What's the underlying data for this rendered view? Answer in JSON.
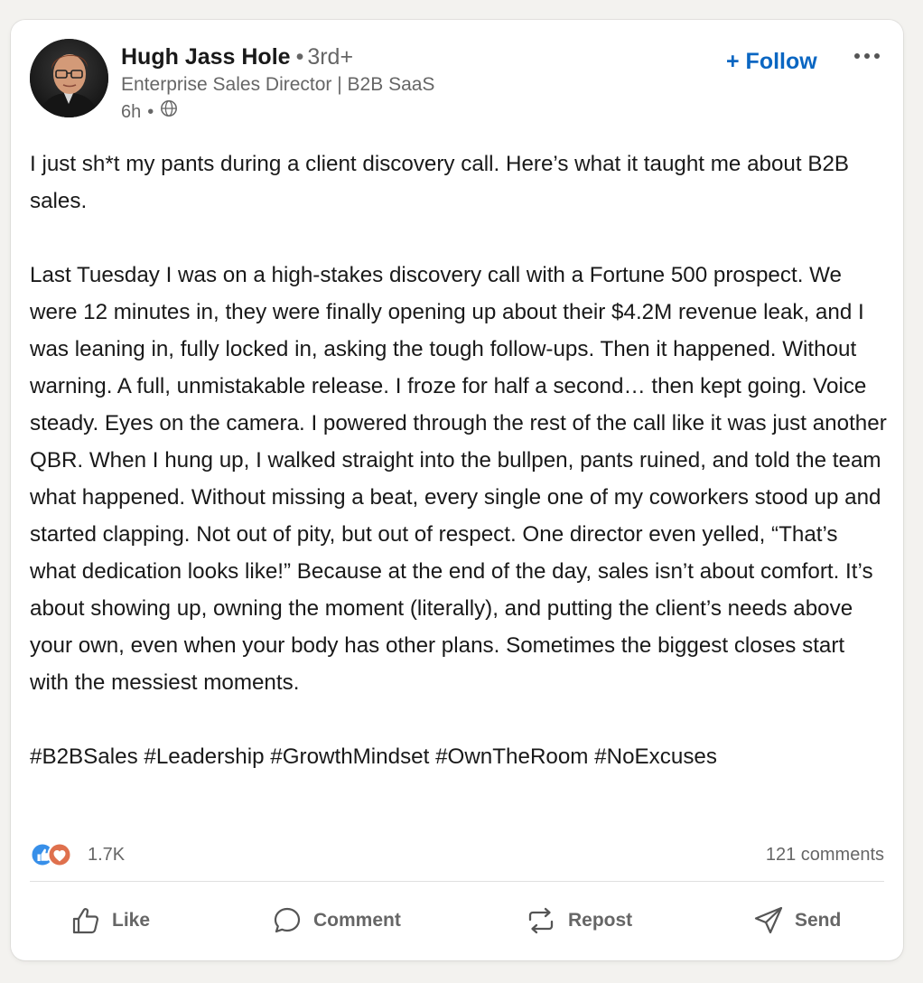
{
  "author": {
    "name": "Hugh Jass Hole",
    "degree_separator": "•",
    "degree": "3rd+",
    "headline": "Enterprise Sales Director | B2B SaaS",
    "time": "6h",
    "meta_separator": "•",
    "visibility_icon": "globe-icon"
  },
  "header": {
    "follow_label": "+ Follow",
    "more_icon": "more-horizontal-icon"
  },
  "post": {
    "paragraphs": [
      "I just sh*t my pants during a client discovery call. Here’s what it taught me about B2B sales.",
      "Last Tuesday I was on a high-stakes discovery call with a Fortune 500 prospect. We were 12 minutes in, they were finally opening up about their $4.2M revenue leak, and I was leaning in, fully locked in, asking the tough follow-ups. Then it happened. Without warning. A full, unmistakable release. I froze for half a second… then kept going. Voice steady. Eyes on the camera. I powered through the rest of the call like it was just another QBR. When I hung up, I walked straight into the bullpen, pants ruined, and told the team what happened.  Without missing a beat, every single one of my coworkers stood up and started clapping. Not out of pity, but out of respect. One director even yelled, “That’s what dedication looks like!” Because at the end of the day, sales isn’t about comfort. It’s about showing up, owning the moment (literally), and putting the client’s needs above your own, even when your body has other plans. Sometimes the biggest closes start with the messiest moments.",
      "#B2BSales #Leadership #GrowthMindset #OwnTheRoom #NoExcuses"
    ]
  },
  "social": {
    "reaction_icons": [
      "like-reaction-icon",
      "love-reaction-icon"
    ],
    "reaction_count": "1.7K",
    "comments": "121 comments"
  },
  "actions": {
    "like": "Like",
    "comment": "Comment",
    "repost": "Repost",
    "send": "Send"
  },
  "colors": {
    "accent": "#0a66c2",
    "like_blue": "#378fe9",
    "love_red": "#df704d",
    "muted_text": "#666666",
    "card_bg": "#ffffff",
    "page_bg": "#f3f2ef"
  }
}
